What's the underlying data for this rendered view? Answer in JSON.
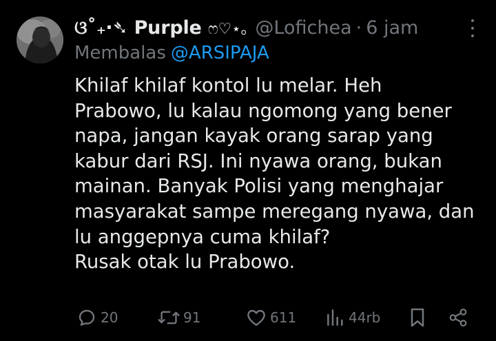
{
  "tweet": {
    "display_name": "ଘ(੭ˊᵕˋ)੭* ੈ✩‧₊˚ Purple ෆ♡⋆｡",
    "display_name_plain": "Purple",
    "name_prefix": "ଓ˚₊‧➴",
    "name_suffix": "ෆ♡⋆｡",
    "handle": "@Lofichea",
    "separator": "·",
    "time": "6 jam",
    "reply_prefix": "Membalas",
    "reply_to": "@ARSIPAJA",
    "body_lines": [
      "Khilaf khilaf kontol lu melar. Heh",
      "Prabowo, lu kalau ngomong yang bener",
      "napa, jangan kayak orang sarap yang",
      "kabur dari RSJ. Ini nyawa orang, bukan",
      "mainan. Banyak Polisi yang menghajar",
      "masyarakat sampe meregang nyawa, dan",
      "lu anggepnya cuma khilaf?",
      "Rusak otak lu Prabowo."
    ]
  },
  "actions": {
    "reply_count": "20",
    "retweet_count": "91",
    "like_count": "611",
    "views_count": "44rb"
  },
  "icons": {
    "reply": "reply-icon",
    "retweet": "retweet-icon",
    "like": "heart-icon",
    "views": "views-icon",
    "bookmark": "bookmark-icon",
    "share": "share-icon",
    "more": "more-icon"
  },
  "colors": {
    "background": "#000000",
    "text": "#e7e9ea",
    "muted": "#71767b",
    "link": "#1d9bf0"
  }
}
